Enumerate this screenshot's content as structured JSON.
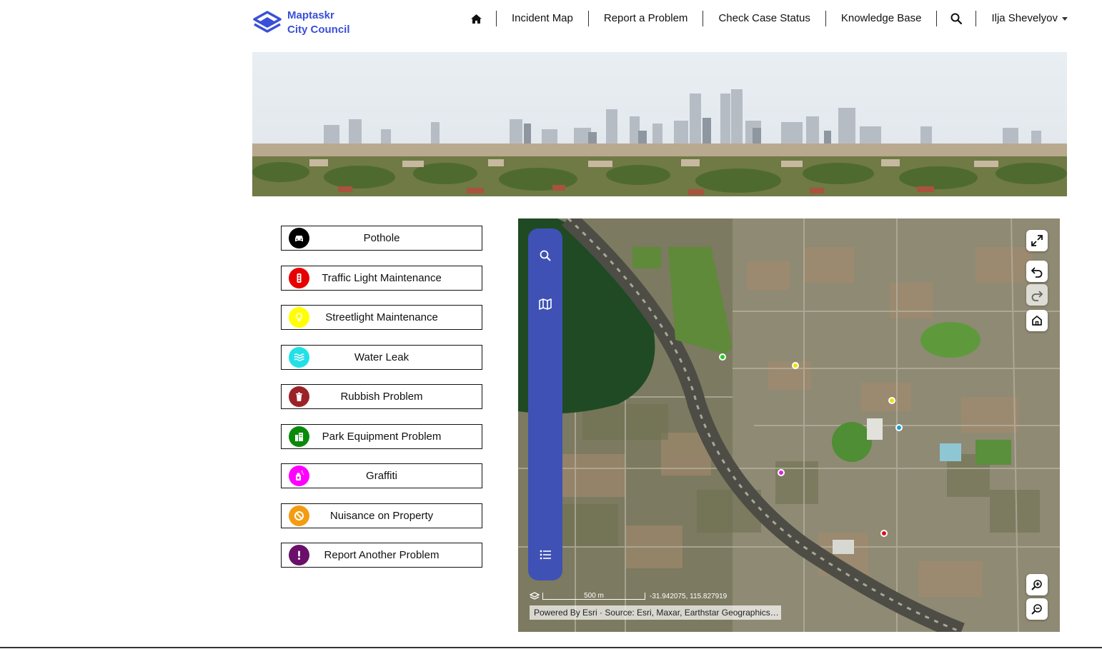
{
  "brand": {
    "line1": "Maptaskr",
    "line2": "City Council",
    "color": "#3a4fd8"
  },
  "nav": {
    "home_icon": "home-icon",
    "items": [
      "Incident Map",
      "Report a Problem",
      "Check Case Status",
      "Knowledge Base"
    ],
    "search_icon": "search-icon",
    "user": "Ilja Shevelyov"
  },
  "categories": [
    {
      "label": "Pothole",
      "icon": "car-icon",
      "color": "#000000"
    },
    {
      "label": "Traffic Light Maintenance",
      "icon": "traffic-light-icon",
      "color": "#e60000"
    },
    {
      "label": "Streetlight Maintenance",
      "icon": "lightbulb-icon",
      "color": "#ffff00"
    },
    {
      "label": "Water Leak",
      "icon": "water-icon",
      "color": "#22e0e8"
    },
    {
      "label": "Rubbish Problem",
      "icon": "trash-icon",
      "color": "#9b2226"
    },
    {
      "label": "Park Equipment Problem",
      "icon": "park-icon",
      "color": "#0a8a0a"
    },
    {
      "label": "Graffiti",
      "icon": "spray-can-icon",
      "color": "#ff00ff"
    },
    {
      "label": "Nuisance on Property",
      "icon": "ban-icon",
      "color": "#f39c12"
    },
    {
      "label": "Report Another Problem",
      "icon": "exclamation-icon",
      "color": "#6a0f6a"
    }
  ],
  "map": {
    "rail_color": "#3f51b5",
    "scale_label": "500 m",
    "coordinates": "-31.942075, 115.827919",
    "attribution": "Powered By Esri · Source: Esri, Maxar, Earthstar Geographics…",
    "markers": [
      {
        "color": "#22cc22"
      },
      {
        "color": "#e6e600"
      },
      {
        "color": "#e6e600"
      },
      {
        "color": "#1e9bd7"
      },
      {
        "color": "#dd22dd"
      },
      {
        "color": "#e01010"
      }
    ]
  }
}
